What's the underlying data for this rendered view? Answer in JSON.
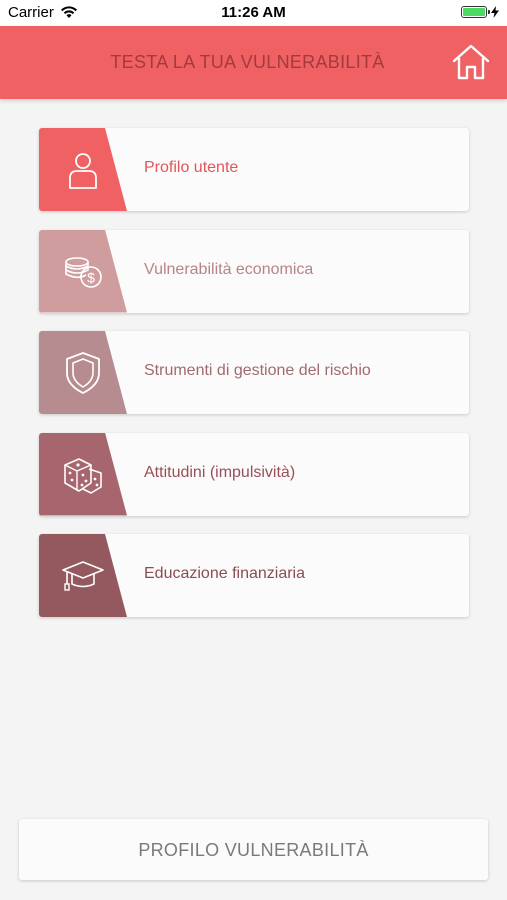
{
  "status_bar": {
    "carrier": "Carrier",
    "time": "11:26 AM"
  },
  "header": {
    "title": "TESTA LA TUA VULNERABILITÀ"
  },
  "menu": {
    "items": [
      {
        "label": "Profilo utente",
        "icon": "user-icon",
        "side_color": "#f06163",
        "label_color": "#e2555a"
      },
      {
        "label": "Vulnerabilità economica",
        "icon": "coins-dollar-icon",
        "side_color": "#d09d9f",
        "label_color": "#b98386"
      },
      {
        "label": "Strumenti di gestione del rischio",
        "icon": "shield-icon",
        "side_color": "#b78c90",
        "label_color": "#a06a70"
      },
      {
        "label": "Attitudini (impulsività)",
        "icon": "dice-icon",
        "side_color": "#a7666e",
        "label_color": "#975058"
      },
      {
        "label": "Educazione finanziaria",
        "icon": "graduation-cap-icon",
        "side_color": "#94595e",
        "label_color": "#8b4c52"
      }
    ]
  },
  "footer": {
    "button_label": "PROFILO VULNERABILITÀ"
  }
}
